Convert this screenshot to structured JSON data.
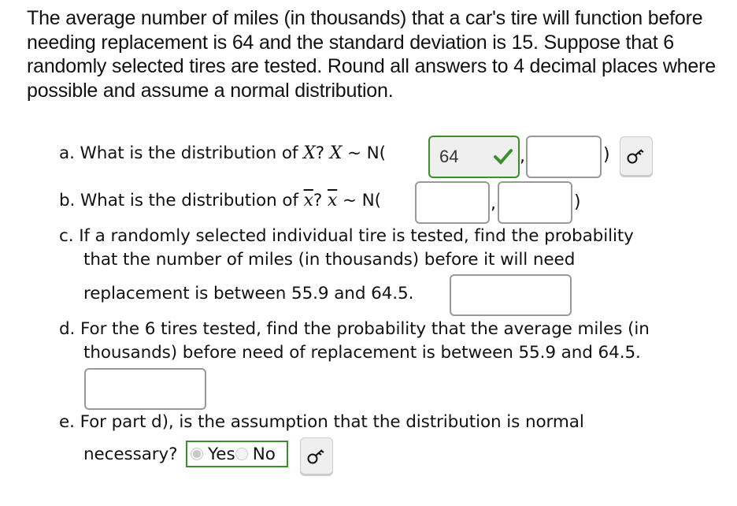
{
  "intro": "The average number of miles (in thousands) that a car's tire will function before needing replacement is 64 and the standard deviation is 15. Suppose that 6 randomly selected tires are tested. Round all answers to 4 decimal places where possible and assume a normal distribution.",
  "part_a": {
    "label": "a. What is the distribution of ",
    "var": "X",
    "q": "?",
    "dist_prefix": "~ N(",
    "mean_value": "64",
    "mean_status": "correct",
    "sd_value": "",
    "comma": ",",
    "close": ")"
  },
  "part_b": {
    "label": "b. What is the distribution of ",
    "var": "x",
    "q": "?",
    "dist_prefix": "~ N(",
    "mean_value": "",
    "sd_value": "",
    "comma": ",",
    "close": ")"
  },
  "part_c": {
    "line1": "c. If a randomly selected individual tire is tested, find the probability",
    "line2": "that the number of miles (in thousands) before it will need",
    "line3": "replacement is between 55.9 and 64.5.",
    "answer_value": ""
  },
  "part_d": {
    "line1": "d. For the 6 tires tested, find the probability that the average miles (in",
    "line2": "thousands) before need of replacement is between 55.9 and 64.5.",
    "answer_value": ""
  },
  "part_e": {
    "line1": "e. For part d), is the assumption that the distribution is normal",
    "line2": "necessary?",
    "options": [
      "Yes",
      "No"
    ],
    "selected": "Yes",
    "status": "correct"
  },
  "icons": {
    "key": "key-icon",
    "check": "checkmark-icon"
  },
  "colors": {
    "correct": "#3a8f2a",
    "input_border": "#999999"
  }
}
